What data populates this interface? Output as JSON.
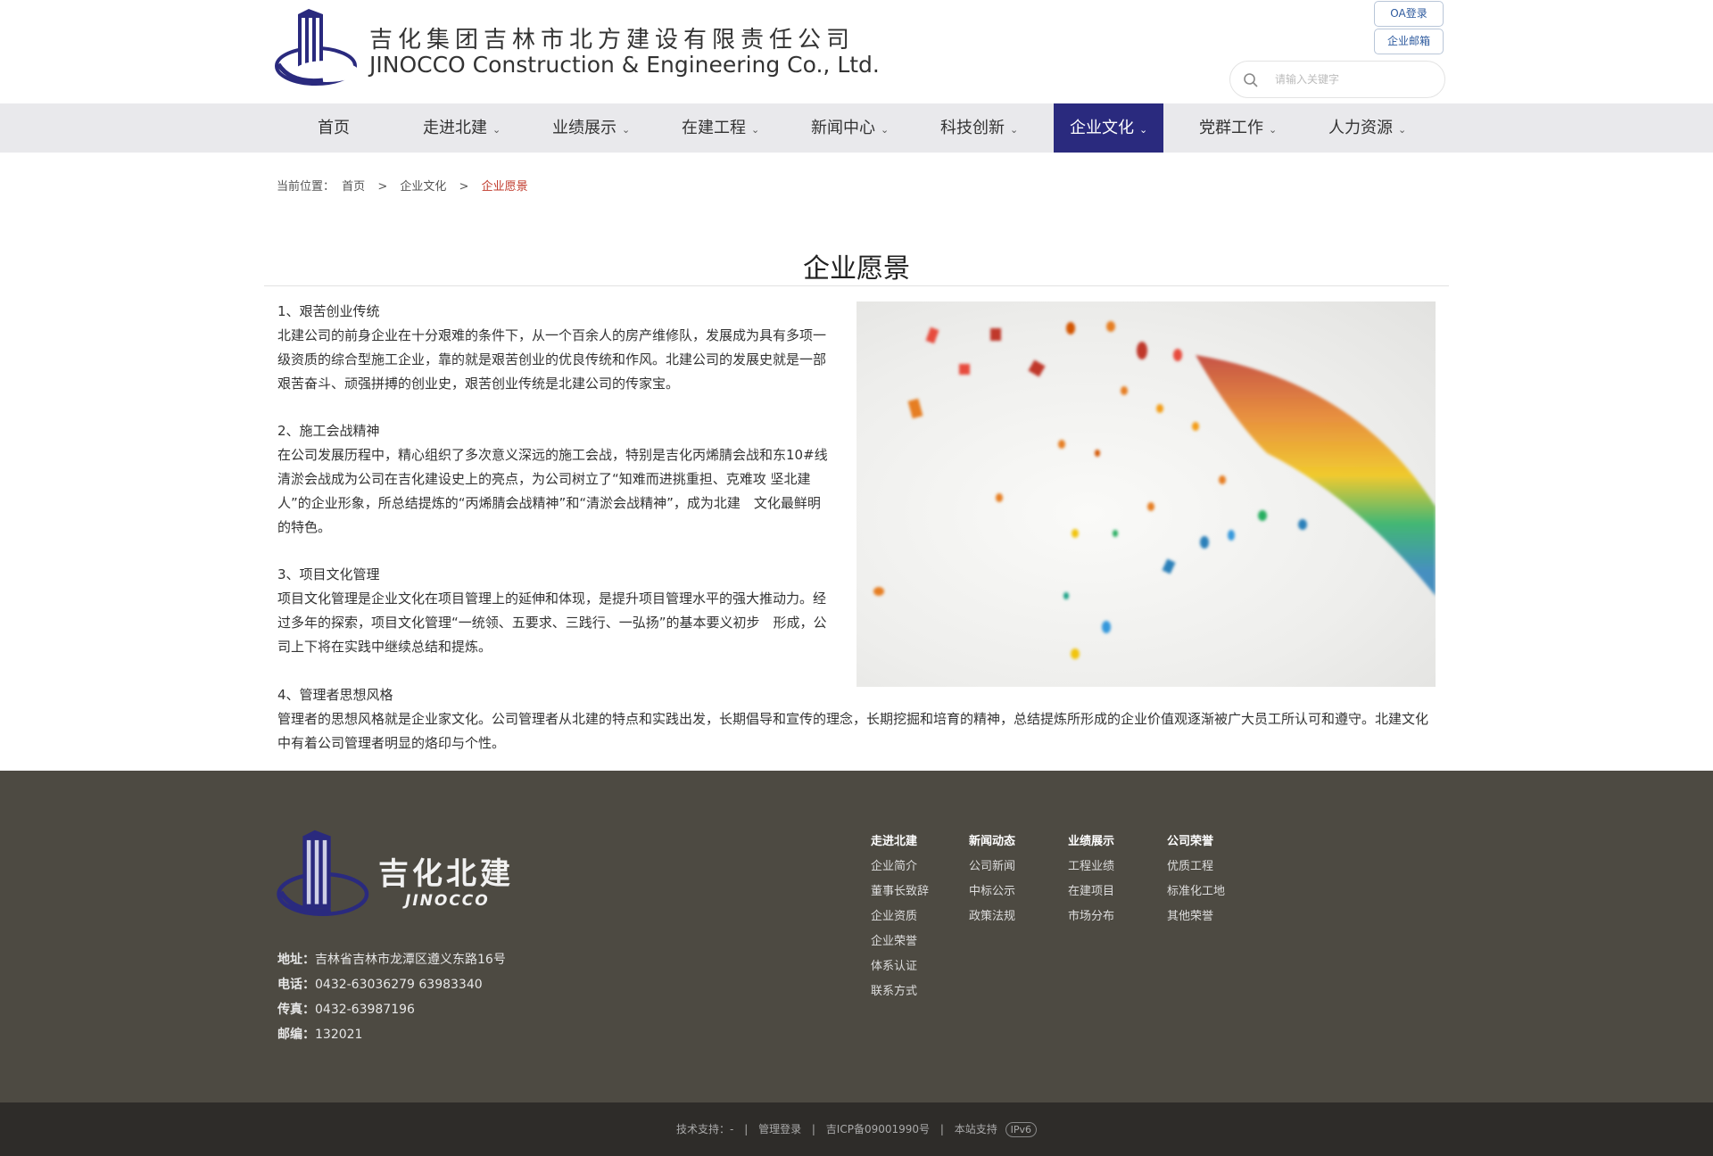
{
  "header": {
    "company_cn": "吉化集团吉林市北方建设有限责任公司",
    "company_en": "JINOCCO Construction & Engineering Co., Ltd.",
    "oa_login": "OA登录",
    "enterprise_mail": "企业邮箱",
    "search_placeholder": "请输入关键字"
  },
  "nav": {
    "items": [
      {
        "label": "首页",
        "dropdown": false
      },
      {
        "label": "走进北建",
        "dropdown": true
      },
      {
        "label": "业绩展示",
        "dropdown": true
      },
      {
        "label": "在建工程",
        "dropdown": true
      },
      {
        "label": "新闻中心",
        "dropdown": true
      },
      {
        "label": "科技创新",
        "dropdown": true
      },
      {
        "label": "企业文化",
        "dropdown": true,
        "active": true
      },
      {
        "label": "党群工作",
        "dropdown": true
      },
      {
        "label": "人力资源",
        "dropdown": true
      }
    ],
    "chevron": "⌄"
  },
  "breadcrumb": {
    "prefix": "当前位置：",
    "home": "首页",
    "sep": ">",
    "parent": "企业文化",
    "current": "企业愿景"
  },
  "page_title": "企业愿景",
  "sections": [
    {
      "title": "1、艰苦创业传统",
      "body": "北建公司的前身企业在十分艰难的条件下，从一个百余人的房产维修队，发展成为具有多项一级资质的综合型施工企业，靠的就是艰苦创业的优良传统和作风。北建公司的发展史就是一部艰苦奋斗、顽强拼搏的创业史，艰苦创业传统是北建公司的传家宝。"
    },
    {
      "title": "2、施工会战精神",
      "body": "在公司发展历程中，精心组织了多次意义深远的施工会战，特别是吉化丙烯腈会战和东10#线清淤会战成为公司在吉化建设史上的亮点，为公司树立了“知难而进挑重担、克难攻 坚北建人”的企业形象，所总结提炼的“丙烯腈会战精神”和“清淤会战精神”，成为北建　文化最鲜明的特色。"
    },
    {
      "title": "3、项目文化管理",
      "body": "项目文化管理是企业文化在项目管理上的延伸和体现，是提升项目管理水平的强大推动力。经过多年的探索，项目文化管理“一统领、五要求、三践行、一弘扬”的基本要义初步　形成，公司上下将在实践中继续总结和提炼。"
    },
    {
      "title": "4、管理者思想风格",
      "body": "管理者的思想风格就是企业家文化。公司管理者从北建的特点和实践出发，长期倡导和宣传的理念，长期挖掘和培育的精神，总结提炼所形成的企业价值观逐渐被广大员工所认可和遵守。北建文化中有着公司管理者明显的烙印与个性。"
    }
  ],
  "footer": {
    "brand_cn": "吉化北建",
    "brand_en": "JINOCCO",
    "address_label": "地址：",
    "address": "吉林省吉林市龙潭区遵义东路16号",
    "phone_label": "电话：",
    "phone": "0432-63036279 63983340",
    "fax_label": "传真：",
    "fax": "0432-63987196",
    "zip_label": "邮编：",
    "zip": "132021",
    "columns": [
      {
        "heading": "走进北建",
        "links": [
          "企业简介",
          "董事长致辞",
          "企业资质",
          "企业荣誉",
          "体系认证",
          "联系方式"
        ]
      },
      {
        "heading": "新闻动态",
        "links": [
          "公司新闻",
          "中标公示",
          "政策法规"
        ]
      },
      {
        "heading": "业绩展示",
        "links": [
          "工程业绩",
          "在建项目",
          "市场分布"
        ]
      },
      {
        "heading": "公司荣誉",
        "links": [
          "优质工程",
          "标准化工地",
          "其他荣誉"
        ]
      }
    ]
  },
  "bottom": {
    "tech_support": "技术支持：-",
    "admin_login": "管理登录",
    "icp": "吉ICP备09001990号",
    "host_label": "本站支持",
    "ipv6": "IPv6"
  },
  "colors": {
    "nav_active": "#2a2a7e",
    "footer_bg": "#4d4a42",
    "bottom_bg": "#2e2c29",
    "breadcrumb_current": "#c0392b"
  }
}
